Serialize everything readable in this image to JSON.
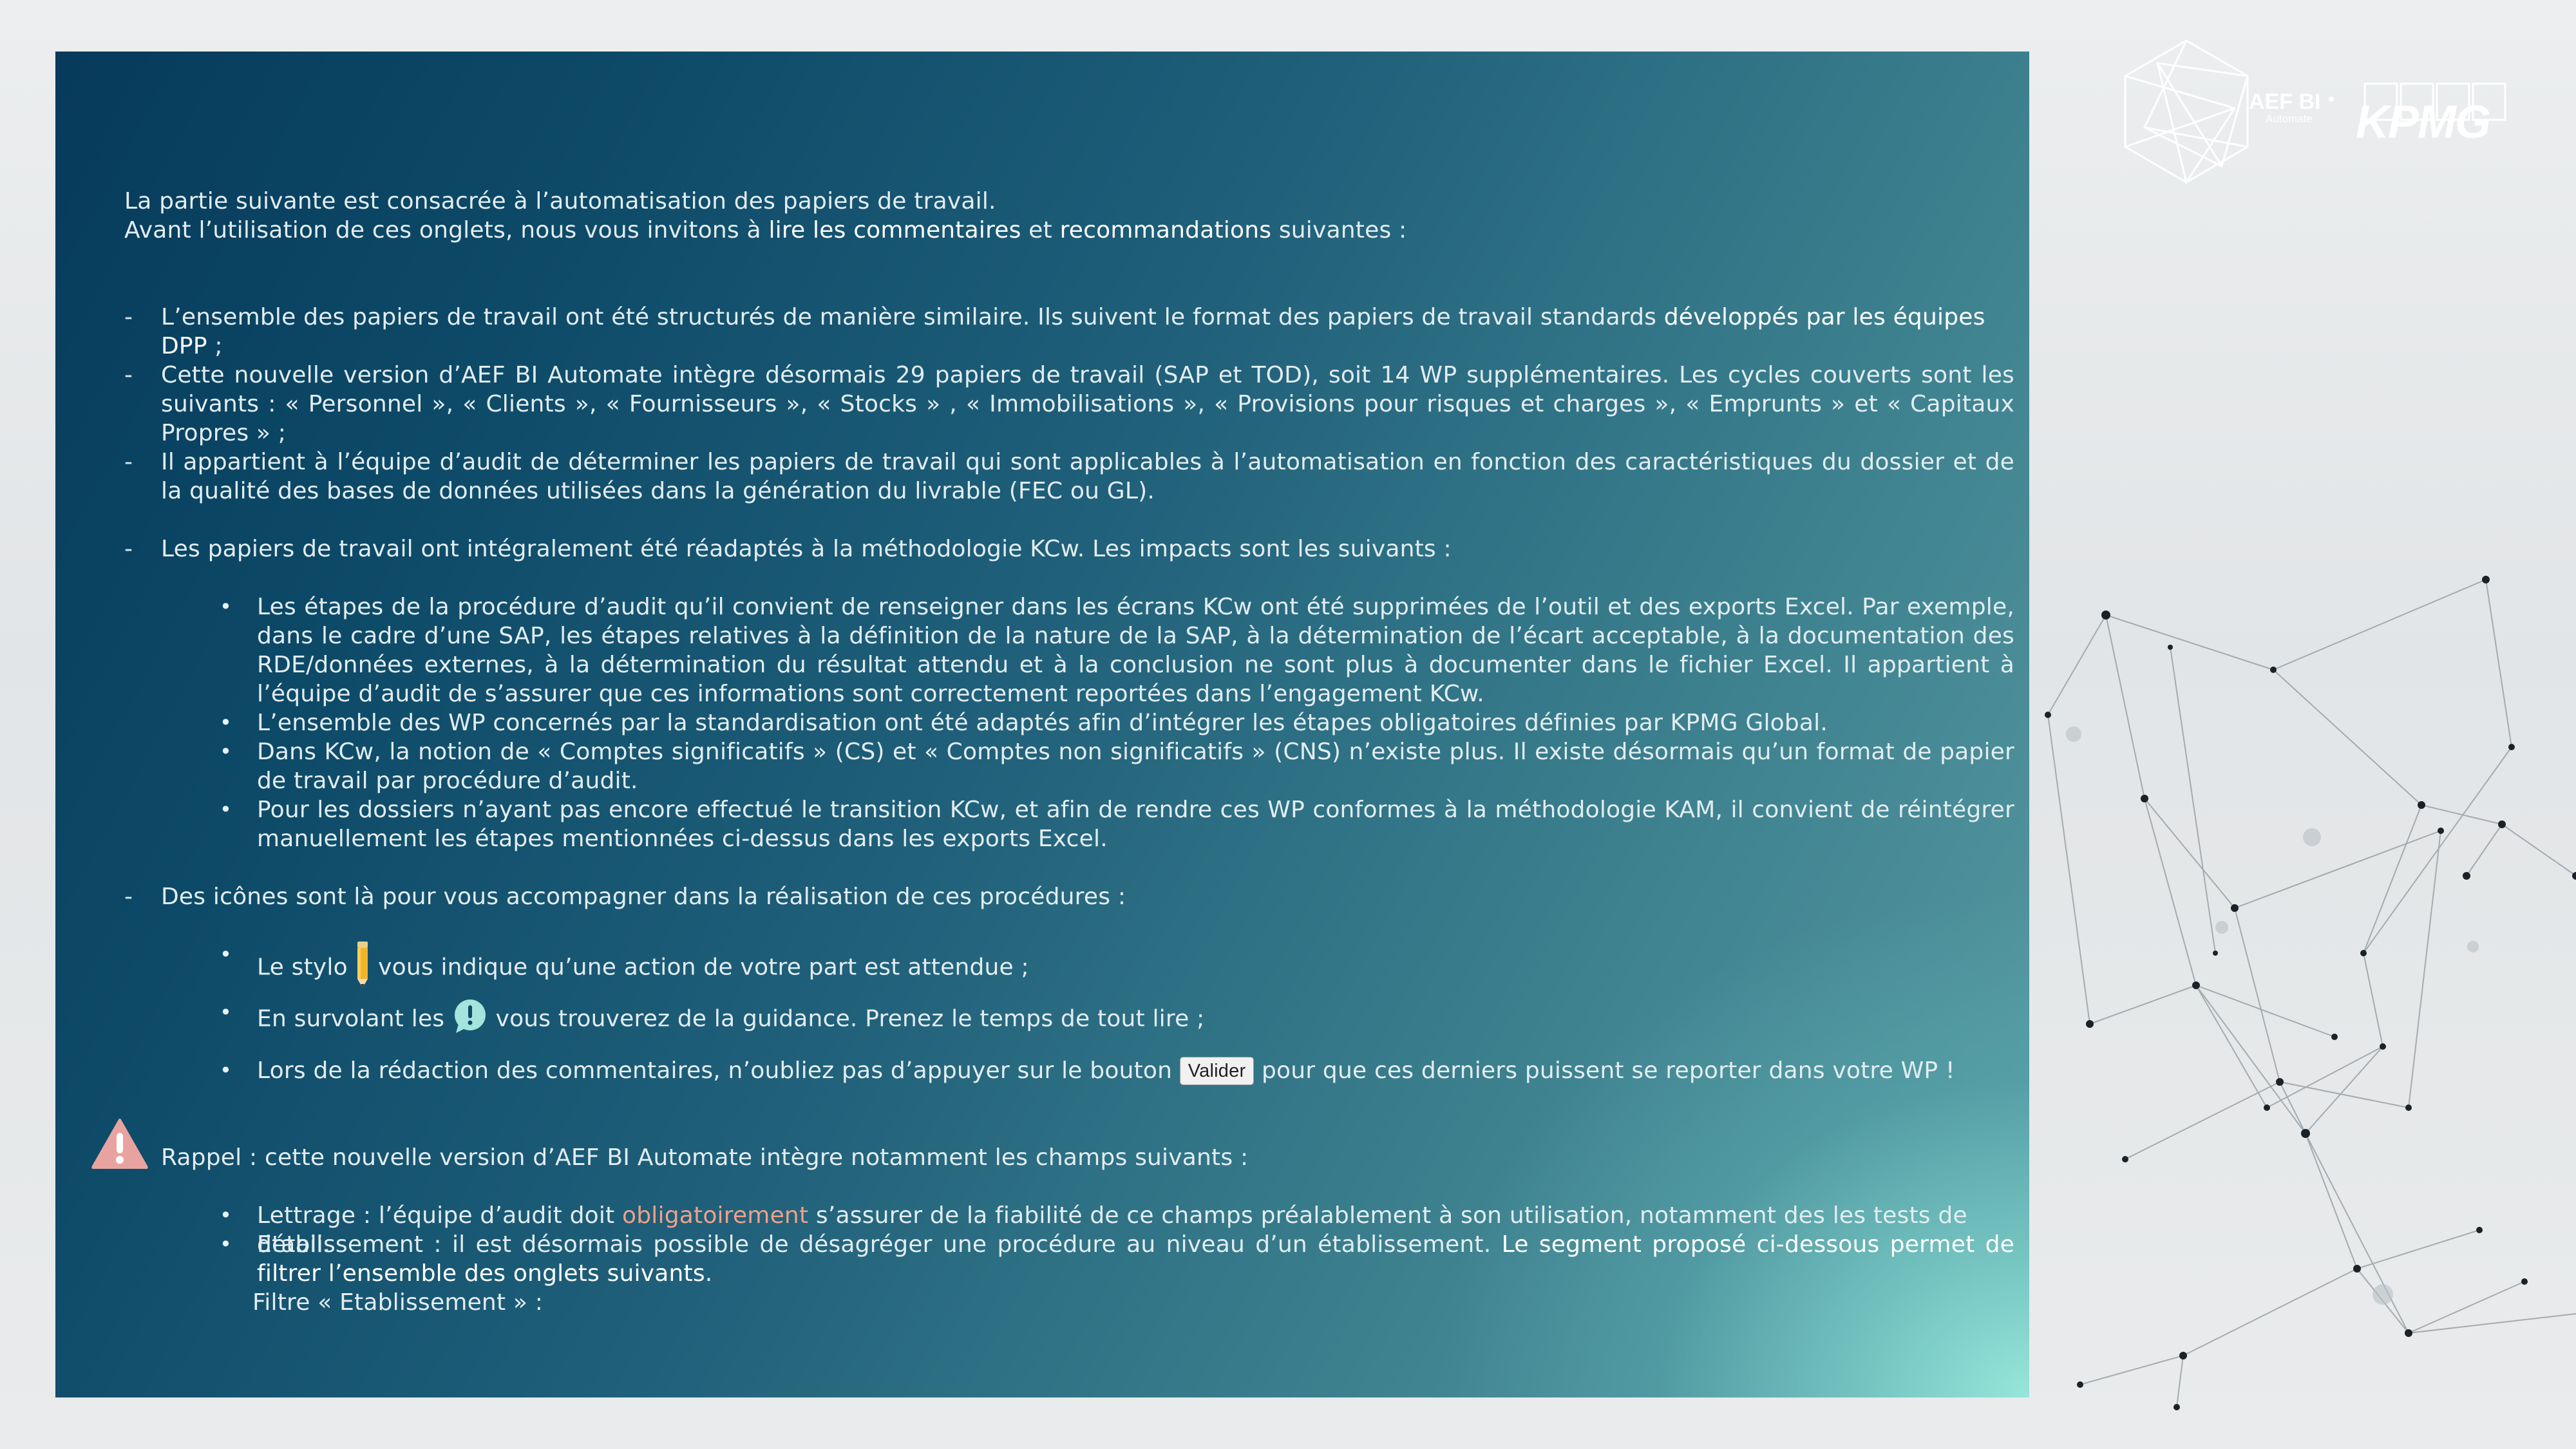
{
  "intro": {
    "line1": "La partie suivante est consacrée à l’automatisation des papiers de travail.",
    "line2_a": "Avant l’utilisation de ces onglets, nous vous invitons à ",
    "line2_b": "lire les commentaires",
    "line2_c": " et ",
    "line2_d": "recommandations",
    "line2_e": " suivantes :"
  },
  "dash": "-",
  "bullet": "•",
  "items": {
    "i1_a": "L’ensemble des papiers de travail ont été structurés de manière similaire. Ils suivent le format des papiers de travail standards ",
    "i1_b": "développés par les équipes DPP",
    "i1_c": " ;",
    "i2": "Cette nouvelle version d’AEF BI Automate intègre désormais 29 papiers de travail (SAP et TOD), soit 14 WP supplémentaires. Les cycles couverts sont les suivants : « Personnel », « Clients », « Fournisseurs », « Stocks » , « Immobilisations », « Provisions pour risques et charges », « Emprunts » et « Capitaux Propres » ;",
    "i3": "Il appartient à l’équipe d’audit de déterminer les papiers de travail qui sont applicables à l’automatisation en fonction des caractéristiques du dossier et de la qualité des bases de données utilisées dans la génération du livrable (FEC ou GL).",
    "i4": "Les papiers de travail ont intégralement été réadaptés à la méthodologie KCw. Les impacts sont les suivants :",
    "i4_sub1": "Les étapes de la procédure d’audit qu’il convient de renseigner dans les écrans KCw ont été supprimées de l’outil et des exports Excel. Par exemple, dans le cadre d’une SAP, les étapes relatives à la définition de la nature de la SAP, à la détermination de l’écart acceptable, à la documentation des RDE/données externes, à la détermination du résultat attendu et à la conclusion ne sont plus à documenter dans le fichier Excel. Il appartient à l’équipe d’audit de s’assurer que ces informations sont correctement reportées dans l’engagement KCw.",
    "i4_sub2": "L’ensemble des WP concernés par la standardisation ont été adaptés afin d’intégrer les étapes obligatoires définies par KPMG Global.",
    "i4_sub3": "Dans KCw, la notion de « Comptes significatifs  » (CS) et « Comptes non significatifs » (CNS) n’existe plus. Il existe désormais qu’un format de papier de travail par procédure d’audit.",
    "i4_sub4": "Pour les dossiers n’ayant pas encore effectué le transition KCw, et afin de rendre ces WP conformes à la méthodologie KAM, il convient de réintégrer manuellement les étapes mentionnées ci-dessus dans les exports Excel.",
    "i5": "Des icônes sont là pour vous accompagner dans la réalisation de ces procédures :",
    "i5_sub1_a": "Le stylo ",
    "i5_sub1_b": " vous indique qu’une action de votre part est attendue ;",
    "i5_sub2_a": "En survolant les ",
    "i5_sub2_b": " vous trouverez de la guidance. Prenez le temps de tout lire ;",
    "i5_sub3_a": "Lors de la rédaction des commentaires, n’oubliez pas d’appuyer sur le bouton ",
    "i5_sub3_button": "Valider",
    "i5_sub3_b": " pour que ces derniers puissent se reporter dans votre WP !"
  },
  "rappel": {
    "title": "Rappel : cette nouvelle version d’AEF BI Automate intègre notamment les champs suivants :",
    "l1_a": "Lettrage : l’équipe d’audit doit ",
    "l1_b": "obligatoirement",
    "l1_c": " s’assurer de la fiabilité de ce champs préalablement à son utilisation, notamment des les tests de détail.",
    "l2_a": "Etablissement : il est désormais possible de désagréger une procédure au niveau d’un établissement. ",
    "l2_b": "Le segment proposé ci-dessous permet de filtrer l’ensemble des onglets suivants.",
    "filter_label": "Filtre « Etablissement » :"
  },
  "logos": {
    "aef_line1": "AEF BI",
    "aef_line2": "Automate",
    "kpmg": "KPMG"
  },
  "colors": {
    "panel_dark": "#073a5b",
    "panel_light": "#96e6da",
    "highlight": "#f0a088",
    "warning": "#e8a3a0"
  }
}
